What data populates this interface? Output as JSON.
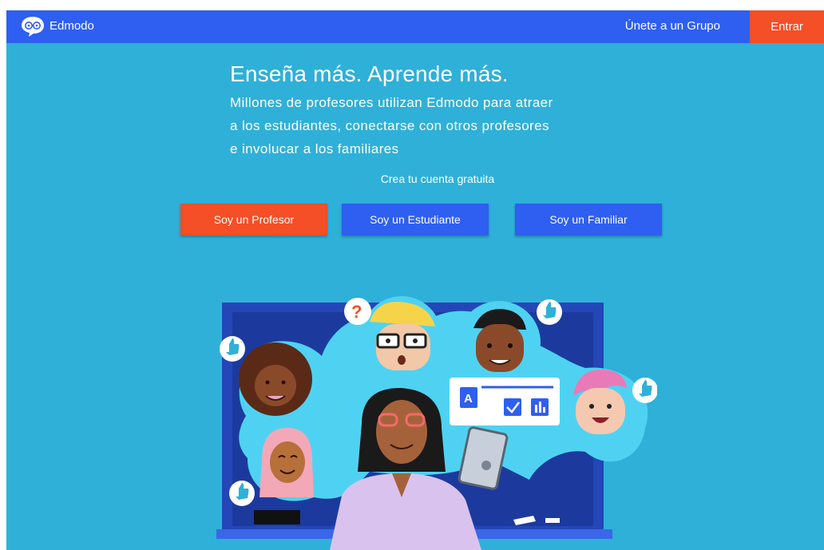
{
  "nav": {
    "brand": "Edmodo",
    "join_group": "Únete a un Grupo",
    "login": "Entrar"
  },
  "hero": {
    "title": "Enseña más. Aprende más.",
    "subtitle_lines": [
      "Millones de profesores utilizan Edmodo para atraer",
      "a los estudiantes, conectarse con otros profesores",
      "e involucar a los familiares"
    ],
    "cta_label": "Crea tu cuenta gratuita"
  },
  "roles": {
    "teacher": "Soy un Profesor",
    "student": "Soy un Estudiante",
    "parent": "Soy un Familiar"
  },
  "colors": {
    "background": "#2fb0d8",
    "navbar": "#2e5ff0",
    "accent": "#f44f26",
    "button_blue": "#2e5ff0"
  },
  "illustration": {
    "question_mark": "?",
    "doc_letter": "A"
  }
}
